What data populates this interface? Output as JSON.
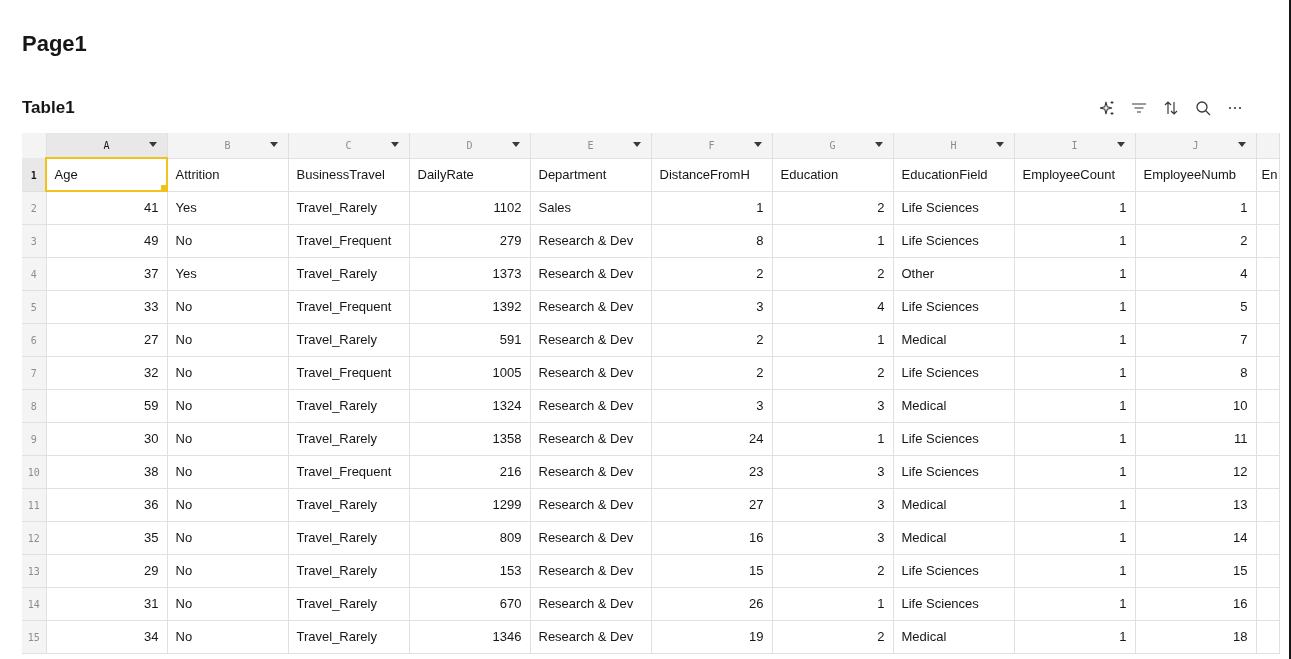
{
  "page_title": "Page1",
  "table": {
    "title": "Table1",
    "toolbar": [
      {
        "kind": "sparkle"
      },
      {
        "kind": "filter"
      },
      {
        "kind": "sort"
      },
      {
        "kind": "search"
      },
      {
        "kind": "more"
      }
    ],
    "columns": [
      {
        "letter": "A",
        "kind": "number",
        "selected": true
      },
      {
        "letter": "B",
        "kind": "text",
        "selected": false
      },
      {
        "letter": "C",
        "kind": "text",
        "selected": false
      },
      {
        "letter": "D",
        "kind": "number",
        "selected": false
      },
      {
        "letter": "E",
        "kind": "text",
        "selected": false
      },
      {
        "letter": "F",
        "kind": "number",
        "selected": false
      },
      {
        "letter": "G",
        "kind": "number",
        "selected": false
      },
      {
        "letter": "H",
        "kind": "text",
        "selected": false
      },
      {
        "letter": "I",
        "kind": "number",
        "selected": false
      },
      {
        "letter": "J",
        "kind": "number",
        "selected": false
      },
      {
        "kind": "partial",
        "selected": false
      }
    ],
    "rows": [
      {
        "number": "1",
        "selected": true,
        "cells": [
          "Age",
          "Attrition",
          "BusinessTravel",
          "DailyRate",
          "Department",
          "DistanceFromH",
          "Education",
          "EducationField",
          "EmployeeCount",
          "EmployeeNumb",
          "En"
        ]
      },
      {
        "number": "2",
        "selected": false,
        "cells": [
          "41",
          "Yes",
          "Travel_Rarely",
          "1102",
          "Sales",
          "1",
          "2",
          "Life Sciences",
          "1",
          "1"
        ]
      },
      {
        "number": "3",
        "selected": false,
        "cells": [
          "49",
          "No",
          "Travel_Frequent",
          "279",
          "Research & Dev",
          "8",
          "1",
          "Life Sciences",
          "1",
          "2"
        ]
      },
      {
        "number": "4",
        "selected": false,
        "cells": [
          "37",
          "Yes",
          "Travel_Rarely",
          "1373",
          "Research & Dev",
          "2",
          "2",
          "Other",
          "1",
          "4"
        ]
      },
      {
        "number": "5",
        "selected": false,
        "cells": [
          "33",
          "No",
          "Travel_Frequent",
          "1392",
          "Research & Dev",
          "3",
          "4",
          "Life Sciences",
          "1",
          "5"
        ]
      },
      {
        "number": "6",
        "selected": false,
        "cells": [
          "27",
          "No",
          "Travel_Rarely",
          "591",
          "Research & Dev",
          "2",
          "1",
          "Medical",
          "1",
          "7"
        ]
      },
      {
        "number": "7",
        "selected": false,
        "cells": [
          "32",
          "No",
          "Travel_Frequent",
          "1005",
          "Research & Dev",
          "2",
          "2",
          "Life Sciences",
          "1",
          "8"
        ]
      },
      {
        "number": "8",
        "selected": false,
        "cells": [
          "59",
          "No",
          "Travel_Rarely",
          "1324",
          "Research & Dev",
          "3",
          "3",
          "Medical",
          "1",
          "10"
        ]
      },
      {
        "number": "9",
        "selected": false,
        "cells": [
          "30",
          "No",
          "Travel_Rarely",
          "1358",
          "Research & Dev",
          "24",
          "1",
          "Life Sciences",
          "1",
          "11"
        ]
      },
      {
        "number": "10",
        "selected": false,
        "cells": [
          "38",
          "No",
          "Travel_Frequent",
          "216",
          "Research & Dev",
          "23",
          "3",
          "Life Sciences",
          "1",
          "12"
        ]
      },
      {
        "number": "11",
        "selected": false,
        "cells": [
          "36",
          "No",
          "Travel_Rarely",
          "1299",
          "Research & Dev",
          "27",
          "3",
          "Medical",
          "1",
          "13"
        ]
      },
      {
        "number": "12",
        "selected": false,
        "cells": [
          "35",
          "No",
          "Travel_Rarely",
          "809",
          "Research & Dev",
          "16",
          "3",
          "Medical",
          "1",
          "14"
        ]
      },
      {
        "number": "13",
        "selected": false,
        "cells": [
          "29",
          "No",
          "Travel_Rarely",
          "153",
          "Research & Dev",
          "15",
          "2",
          "Life Sciences",
          "1",
          "15"
        ]
      },
      {
        "number": "14",
        "selected": false,
        "cells": [
          "31",
          "No",
          "Travel_Rarely",
          "670",
          "Research & Dev",
          "26",
          "1",
          "Life Sciences",
          "1",
          "16"
        ]
      },
      {
        "number": "15",
        "selected": false,
        "cells": [
          "34",
          "No",
          "Travel_Rarely",
          "1346",
          "Research & Dev",
          "19",
          "2",
          "Medical",
          "1",
          "18"
        ]
      }
    ]
  }
}
